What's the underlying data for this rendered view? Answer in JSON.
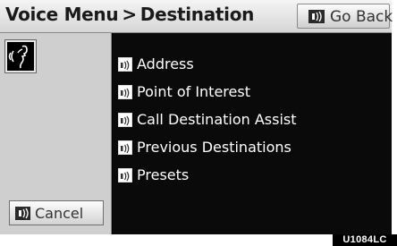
{
  "header": {
    "title_part1": "Voice Menu",
    "separator": ">",
    "title_part2": "Destination",
    "go_back_label": "Go Back"
  },
  "sidebar": {
    "voice_icon": "voice-speaking-icon",
    "cancel_label": "Cancel"
  },
  "menu": {
    "items": [
      {
        "label": "Address",
        "icon": "voice-command-icon"
      },
      {
        "label": "Point of Interest",
        "icon": "voice-command-icon"
      },
      {
        "label": "Call Destination Assist",
        "icon": "voice-command-icon"
      },
      {
        "label": "Previous Destinations",
        "icon": "voice-command-icon"
      },
      {
        "label": "Presets",
        "icon": "voice-command-icon"
      }
    ]
  },
  "figure_code": "U1084LC"
}
